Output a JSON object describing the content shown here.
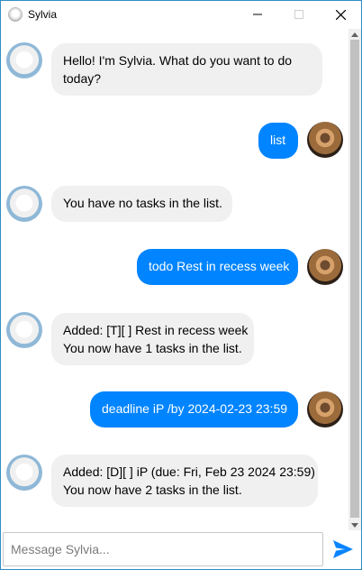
{
  "window": {
    "title": "Sylvia"
  },
  "messages": [
    {
      "sender": "bot",
      "lines": [
        "Hello! I'm Sylvia. What do you want to do",
        "today?"
      ]
    },
    {
      "sender": "user",
      "lines": [
        "list"
      ]
    },
    {
      "sender": "bot",
      "lines": [
        "You have no tasks in the list."
      ]
    },
    {
      "sender": "user",
      "lines": [
        "todo Rest in recess week"
      ]
    },
    {
      "sender": "bot",
      "lines": [
        "Added: [T][ ] Rest in recess week",
        "You now have 1 tasks in the list."
      ]
    },
    {
      "sender": "user",
      "lines": [
        "deadline iP /by 2024-02-23 23:59"
      ]
    },
    {
      "sender": "bot",
      "lines": [
        "Added: [D][ ] iP (due: Fri, Feb 23 2024 23:59)",
        "You now have 2 tasks in the list."
      ]
    }
  ],
  "input": {
    "placeholder": "Message Sylvia...",
    "value": ""
  },
  "colors": {
    "user_bubble": "#0084ff",
    "bot_bubble": "#f0f0f0",
    "send_icon": "#0a84ff"
  },
  "icons": {
    "send": "send-icon",
    "bot_avatar": "bot-avatar",
    "user_avatar": "user-avatar"
  }
}
